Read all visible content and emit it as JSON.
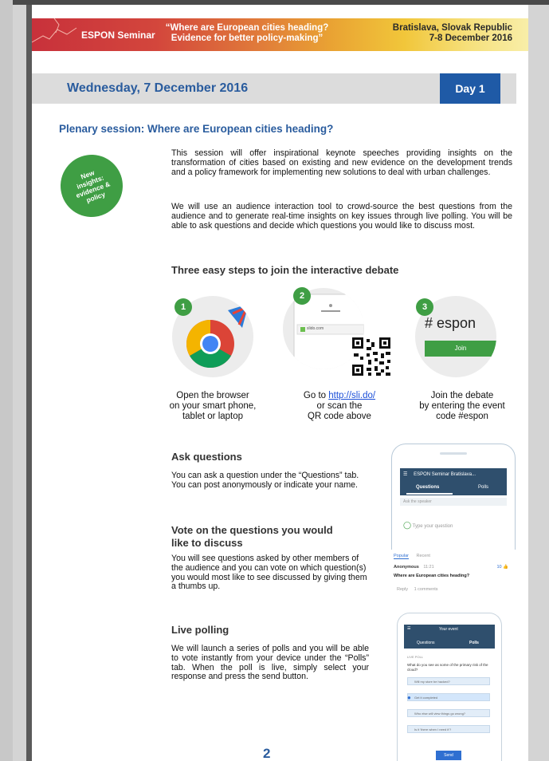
{
  "banner": {
    "brand": "ESPON Seminar",
    "quote_line1": "“Where are European cities heading?",
    "quote_line2": "Evidence for better policy-making”",
    "place_line1": "Bratislava, Slovak Republic",
    "place_line2": "7-8 December 2016"
  },
  "datebar": {
    "date": "Wednesday, 7 December 2016",
    "day": "Day 1"
  },
  "session": {
    "title": "Plenary session: Where are European cities heading?",
    "badge": "New insights: evidence & policy",
    "paragraph1": "This session will offer inspirational keynote speeches providing insights on the transformation of cities based on existing and new evidence on the development trends and a policy framework for implementing new solutions to deal with urban challenges.",
    "paragraph2": "We will use an audience interaction tool to crowd-source the best questions from the audience and to generate real-time insights on key issues through live polling. You will be able to ask questions and decide which questions you would like to discuss most."
  },
  "steps": {
    "heading": "Three easy steps to join the interactive debate",
    "items": [
      {
        "number": "1",
        "line1": "Open the browser",
        "line2": "on your smart phone,",
        "line3": "tablet or laptop"
      },
      {
        "number": "2",
        "prefix": "Go to ",
        "link": "http://sli.do/",
        "line2": "or scan the",
        "line3": "QR code above",
        "browser_url": "slido.com"
      },
      {
        "number": "3",
        "line1": "Join the debate",
        "line2": "by entering the event",
        "line3": "code #espon",
        "code": "# espon",
        "join_label": "Join"
      }
    ]
  },
  "ask": {
    "heading": "Ask questions",
    "text": "You can ask a question under the “Questions” tab. You can post anonymously or indicate your name."
  },
  "vote": {
    "heading": "Vote on the questions you would like to discuss",
    "text": "You will see questions asked by other members of the audience and you can vote on which question(s) you would most like to see discussed by giving them a thumbs up."
  },
  "polling": {
    "heading": "Live polling",
    "text": "We will launch a series of polls and you will be able to vote instantly from your device under the “Polls” tab. When the poll is live, simply select your response and press the send button."
  },
  "phone1": {
    "title": "ESPON Seminar Bratislava...",
    "tab_questions": "Questions",
    "tab_polls": "Polls",
    "ask_label": "Ask the speaker",
    "input_placeholder": "Type your question"
  },
  "question_panel": {
    "tab_popular": "Popular",
    "tab_recent": "Recent",
    "author": "Anonymous",
    "time": "11:21",
    "votes": "10",
    "question": "Where are European cities heading?",
    "reply": "Reply",
    "comments": "1 comments"
  },
  "phone2": {
    "title": "Your event",
    "tab_questions": "Questions",
    "tab_polls": "Polls",
    "status": "LIVE POLL",
    "question": "What do you see as some of the primary risk of the cloud?",
    "options": [
      "Will my store be hacked?",
      "Get it completed",
      "Who else will view things go wrong?",
      "Is it 'there when I need it'?"
    ],
    "send": "Send"
  },
  "page_number": "2",
  "colors": {
    "heading_blue": "#2a5c9e",
    "day_blue": "#1f5aa6",
    "badge_green": "#3f9e44"
  }
}
